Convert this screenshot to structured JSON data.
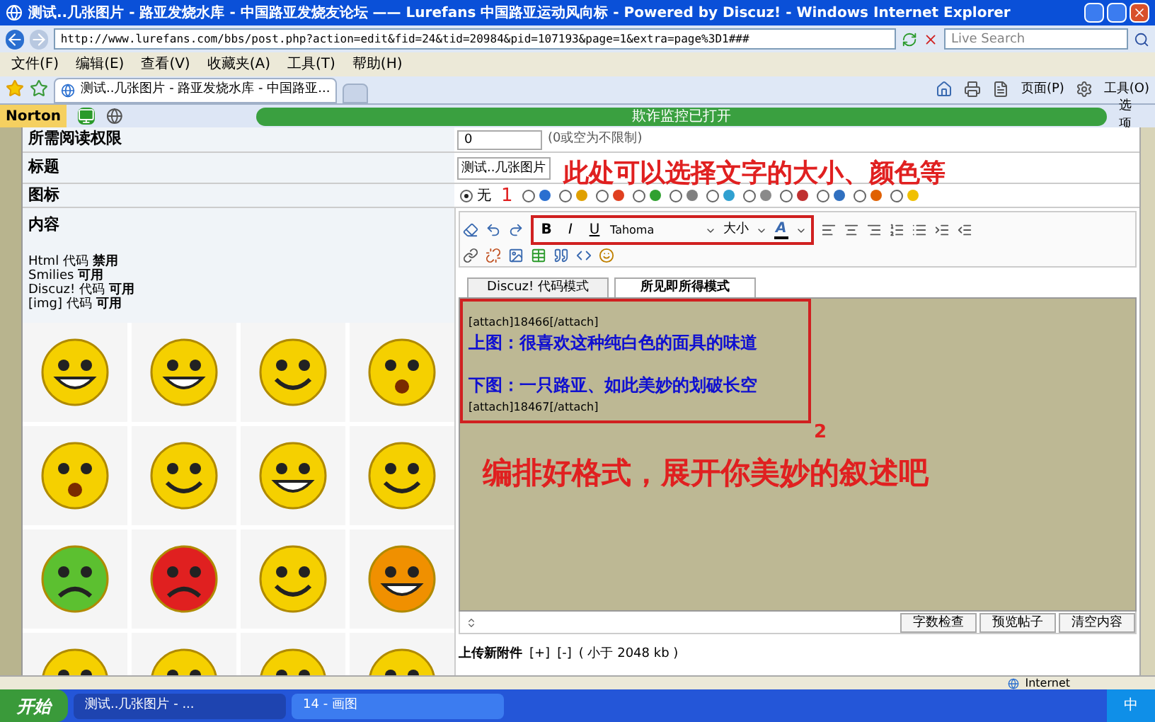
{
  "window": {
    "title": "测试..几张图片 - 路亚发烧水库 - 中国路亚发烧友论坛 —— Lurefans 中国路亚运动风向标 - Powered by Discuz! - Windows Internet Explorer"
  },
  "address_bar": {
    "url": "http://www.lurefans.com/bbs/post.php?action=edit&fid=24&tid=20984&pid=107193&page=1&extra=page%3D1###"
  },
  "search": {
    "placeholder": "Live Search"
  },
  "menu": [
    "文件(F)",
    "编辑(E)",
    "查看(V)",
    "收藏夹(A)",
    "工具(T)",
    "帮助(H)"
  ],
  "tabs": [
    {
      "label": "测试..几张图片 - 路亚发烧水库 - 中国路亚...",
      "selected": true
    }
  ],
  "command_bar": [
    "页面(P)",
    "工具(O)"
  ],
  "norton": {
    "logo": "Norton",
    "status": "欺诈监控已打开",
    "options": "选项"
  },
  "form": {
    "read_permission": {
      "label": "所需阅读权限",
      "value": "0",
      "hint": "(0或空为不限制)"
    },
    "subject": {
      "label": "标题",
      "value": "测试..几张图片"
    },
    "icon_row": {
      "label": "图标",
      "options": [
        {
          "label": "无",
          "selected": true
        },
        {
          "selected": false
        },
        {
          "selected": false
        },
        {
          "selected": false
        },
        {
          "selected": false
        },
        {
          "selected": false
        },
        {
          "selected": false
        },
        {
          "selected": false
        },
        {
          "selected": false
        },
        {
          "selected": false
        },
        {
          "selected": false
        },
        {
          "selected": false
        }
      ]
    },
    "content": {
      "label": "内容",
      "code_status": [
        {
          "name": "Html 代码",
          "state": "禁用"
        },
        {
          "name": "Smilies",
          "state": "可用"
        },
        {
          "name": "Discuz! 代码",
          "state": "可用"
        },
        {
          "name": "[img] 代码",
          "state": "可用"
        }
      ]
    }
  },
  "editor": {
    "format_buttons": [
      "B",
      "I",
      "U"
    ],
    "font": "Tahoma",
    "size": "大小",
    "font_color": "A",
    "modes": [
      {
        "label": "Discuz! 代码模式",
        "selected": false
      },
      {
        "label": "所见即所得模式",
        "selected": true
      }
    ],
    "lines": [
      {
        "kind": "code",
        "text": "[attach]18466[/attach]"
      },
      {
        "kind": "caption",
        "text": "上图：很喜欢这种纯白色的面具的味道"
      },
      {
        "kind": "blank"
      },
      {
        "kind": "caption",
        "text": "下图：一只路亚、如此美妙的划破长空"
      },
      {
        "kind": "code",
        "text": "[attach]18467[/attach]"
      }
    ],
    "buttons": [
      "字数检查",
      "预览帖子",
      "清空内容"
    ],
    "upload": {
      "label": "上传新附件",
      "add": "[+]",
      "remove": "[-]",
      "limit": "( 小于  2048 kb )"
    }
  },
  "annotations": {
    "toolbar_note": "此处可以选择文字的大小、颜色等",
    "marker_1": "1",
    "marker_2": "2",
    "content_note": "编排好格式，展开你美妙的叙述吧"
  },
  "status_bar": {
    "zone": "Internet"
  },
  "taskbar": {
    "start": "开始",
    "tasks": [
      {
        "label": "测试..几张图片 - ...",
        "selected": true
      },
      {
        "label": "14 - 画图",
        "selected": false
      }
    ],
    "tray": "中"
  }
}
